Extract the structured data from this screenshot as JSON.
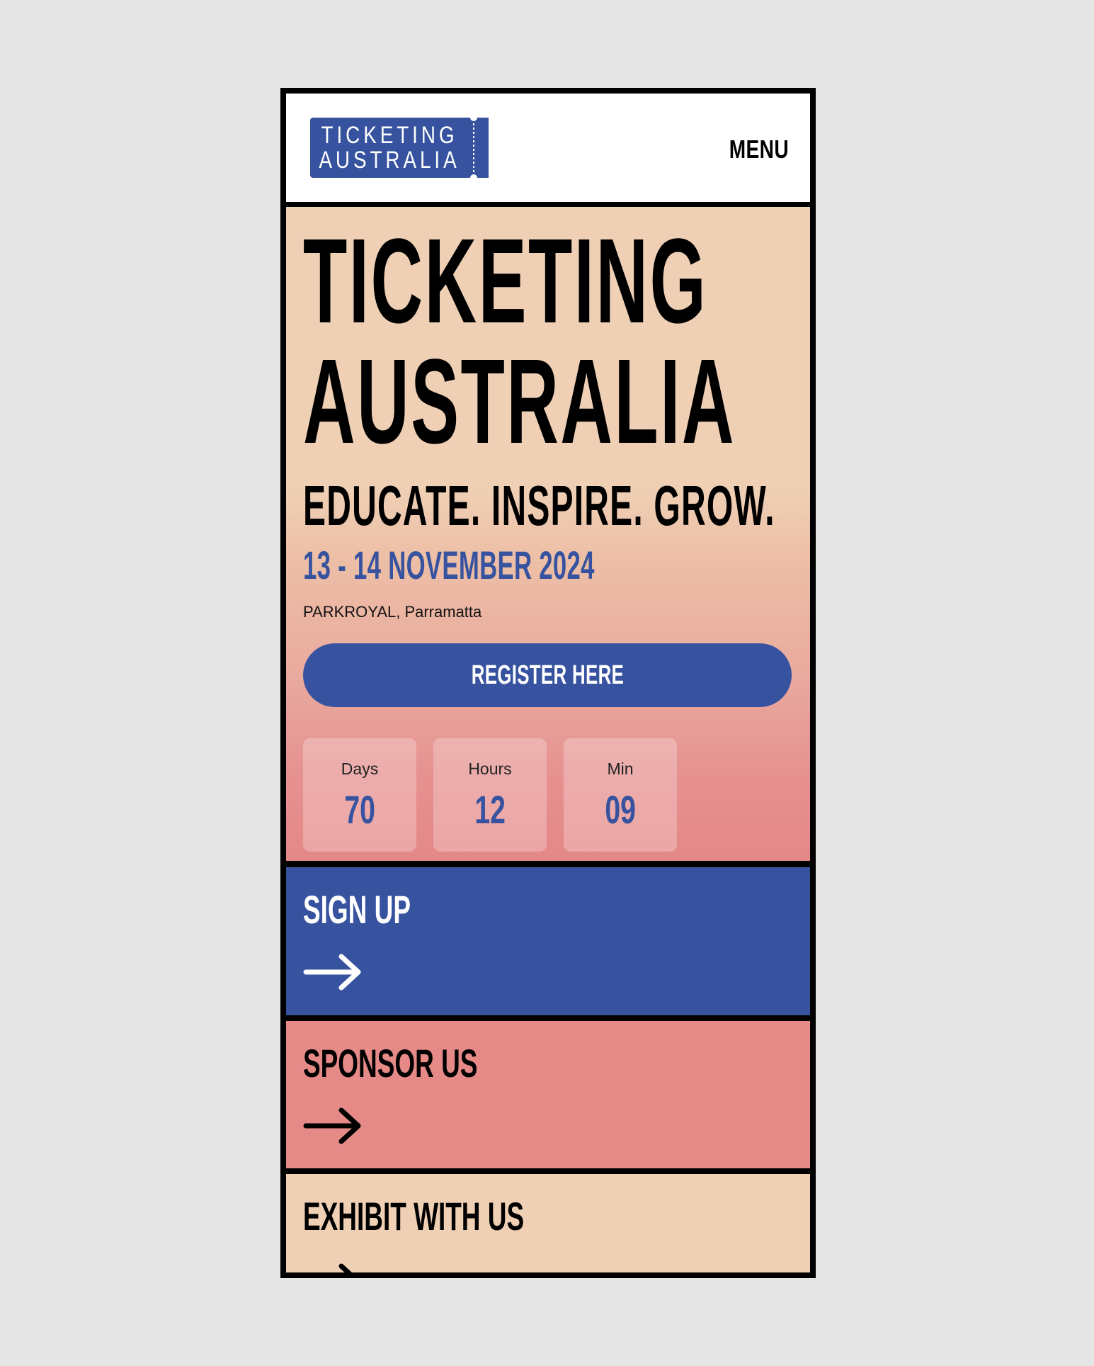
{
  "header": {
    "logo_text": [
      "TICKETING",
      "AUSTRALIA"
    ],
    "menu_label": "MENU"
  },
  "hero": {
    "title_line1": "TICKETING",
    "title_line2": "AUSTRALIA",
    "tagline": "EDUCATE. INSPIRE. GROW.",
    "date": "13 - 14 NOVEMBER 2024",
    "venue": "PARKROYAL, Parramatta",
    "register_label": "REGISTER HERE"
  },
  "countdown": [
    {
      "label": "Days",
      "value": "70"
    },
    {
      "label": "Hours",
      "value": "12"
    },
    {
      "label": "Min",
      "value": "09"
    }
  ],
  "ctas": [
    {
      "label": "SIGN UP",
      "icon": "arrow-right-icon"
    },
    {
      "label": "SPONSOR US",
      "icon": "arrow-right-icon"
    },
    {
      "label": "EXHIBIT WITH US",
      "icon": "arrow-right-icon"
    }
  ],
  "colors": {
    "brand_blue": "#3753a0",
    "peach": "#efd0b5",
    "coral": "#e68a88",
    "page_bg": "#e5e5e5"
  }
}
